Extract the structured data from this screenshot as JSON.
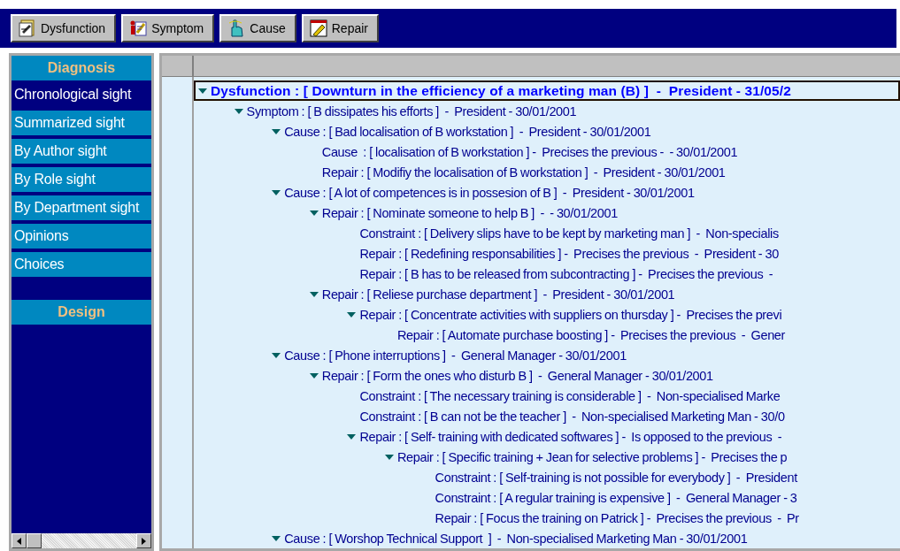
{
  "toolbar": [
    {
      "label": "Dysfunction",
      "kind": "dysfunction"
    },
    {
      "label": "Symptom",
      "kind": "symptom"
    },
    {
      "label": "Cause",
      "kind": "cause"
    },
    {
      "label": "Repair",
      "kind": "repair"
    }
  ],
  "sidebar": {
    "sections": [
      {
        "title": "Diagnosis",
        "items": [
          {
            "label": "Chronological sight",
            "selected": true
          },
          {
            "label": "Summarized sight",
            "selected": false
          },
          {
            "label": "By Author sight",
            "selected": false
          },
          {
            "label": "By Role sight",
            "selected": false
          },
          {
            "label": "By Department sight",
            "selected": false
          },
          {
            "label": "Opinions",
            "selected": false
          },
          {
            "label": "Choices",
            "selected": false
          }
        ]
      },
      {
        "title": "Design"
      }
    ]
  },
  "tree": [
    {
      "text": "Dysfunction : [ Downturn in the efficiency of a marketing man (B) ]  -  President - 31/05/2",
      "expanded": true,
      "selected": true,
      "children": [
        {
          "text": "Symptom : [ B dissipates his efforts ]  -  President - 30/01/2001",
          "expanded": true,
          "selected": false,
          "children": [
            {
              "text": "Cause : [ Bad localisation of B workstation ]  -  President - 30/01/2001",
              "expanded": true,
              "selected": false,
              "children": [
                {
                  "text": "Cause  : [ localisation of B workstation ] -  Precises the previous -  - 30/01/2001",
                  "selected": false
                },
                {
                  "text": "Repair : [ Modifiy the localisation of B workstation ]  -  President - 30/01/2001",
                  "selected": false
                }
              ]
            },
            {
              "text": "Cause : [ A lot of competences is in possesion of B ]  -  President - 30/01/2001",
              "expanded": true,
              "selected": false,
              "children": [
                {
                  "text": "Repair : [ Nominate someone to help B ]  -  - 30/01/2001",
                  "expanded": true,
                  "selected": false,
                  "children": [
                    {
                      "text": "Constraint : [ Delivery slips have to be kept by marketing man ]  -  Non-specialis",
                      "selected": false
                    },
                    {
                      "text": "Repair : [ Redefining responsabilities ] -  Precises the previous  -  President - 30",
                      "selected": false
                    },
                    {
                      "text": "Repair : [ B has to be released from subcontracting ] -  Precises the previous  -",
                      "selected": false
                    }
                  ]
                },
                {
                  "text": "Repair : [ Reliese purchase department ]  -  President - 30/01/2001",
                  "expanded": true,
                  "selected": false,
                  "children": [
                    {
                      "text": "Repair : [ Concentrate activities with suppliers on thursday ] -  Precises the previ",
                      "expanded": true,
                      "selected": false,
                      "children": [
                        {
                          "text": "Repair : [ Automate purchase boosting ] -  Precises the previous  -  Gener",
                          "selected": false
                        }
                      ]
                    }
                  ]
                }
              ]
            },
            {
              "text": "Cause : [ Phone interruptions ]  -  General Manager - 30/01/2001",
              "expanded": true,
              "selected": false,
              "children": [
                {
                  "text": "Repair : [ Form the ones who disturb B ]  -  General Manager - 30/01/2001",
                  "expanded": true,
                  "selected": false,
                  "children": [
                    {
                      "text": "Constraint : [ The necessary training is considerable ]  -  Non-specialised Marke",
                      "selected": false
                    },
                    {
                      "text": "Constraint : [ B can not be the teacher ]  -  Non-specialised Marketing Man - 30/0",
                      "selected": false
                    },
                    {
                      "text": "Repair : [ Self- training with dedicated softwares ] -  Is opposed to the previous  -",
                      "expanded": true,
                      "selected": false,
                      "children": [
                        {
                          "text": "Repair : [ Specific training + Jean for selective problems ] -  Precises the p",
                          "expanded": true,
                          "selected": false,
                          "children": [
                            {
                              "text": "Constraint : [ Self-training is not possible for everybody ]  -  President",
                              "selected": false
                            },
                            {
                              "text": "Constraint : [ A regular training is expensive ]  -  General Manager - 3",
                              "selected": false
                            },
                            {
                              "text": "Repair : [ Focus the training on Patrick ] -  Precises the previous  -  Pr",
                              "selected": false
                            }
                          ]
                        }
                      ]
                    }
                  ]
                }
              ]
            },
            {
              "text": "Cause : [ Worshop Technical Support  ]  -  Non-specialised Marketing Man - 30/01/2001",
              "expanded": true,
              "selected": false
            }
          ]
        }
      ]
    }
  ]
}
